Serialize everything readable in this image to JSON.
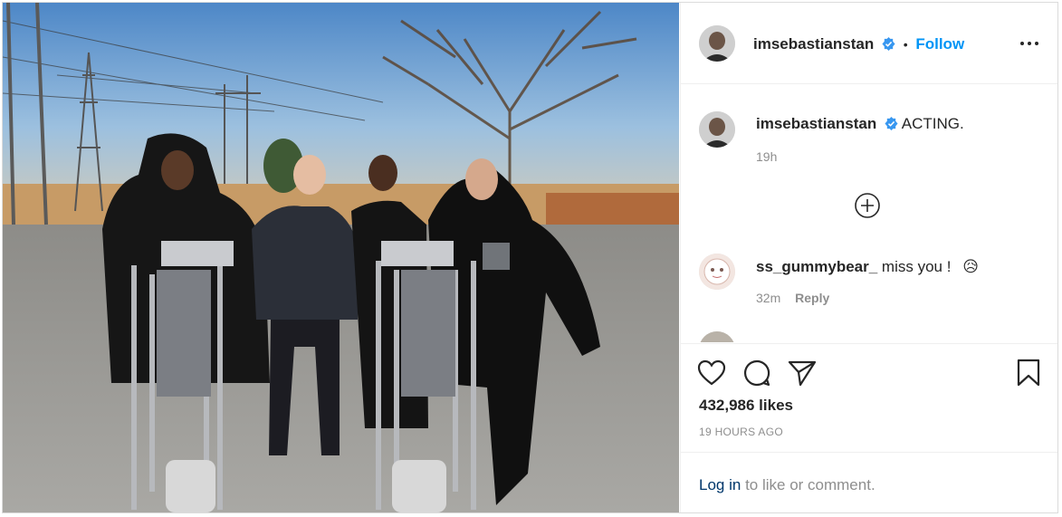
{
  "post": {
    "username": "imsebastianstan",
    "follow_label": "Follow",
    "separator": "•",
    "caption": "ACTING.",
    "caption_time": "19h",
    "likes": "432,986 likes",
    "time_ago": "19 HOURS AGO"
  },
  "comments": [
    {
      "username": "ss_gummybear_",
      "text": "miss you !",
      "emoji": "😥",
      "time": "32m",
      "reply_label": "Reply"
    }
  ],
  "login": {
    "link": "Log in",
    "rest": "to like or comment."
  },
  "colors": {
    "accent": "#0095f6",
    "verified": "#3897f0",
    "muted": "#8e8e8e"
  }
}
